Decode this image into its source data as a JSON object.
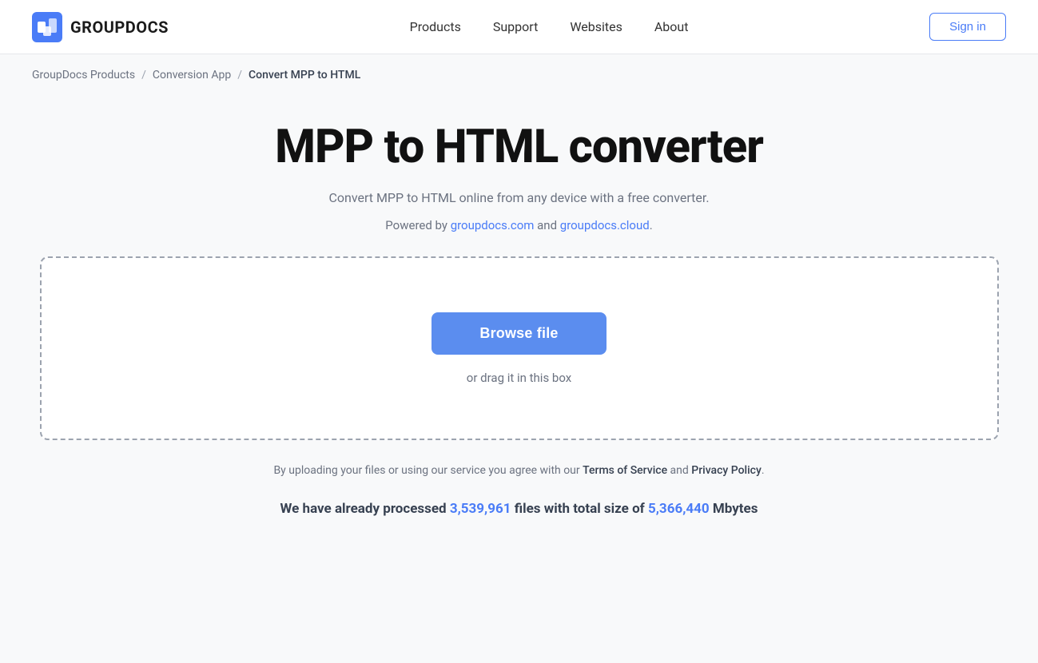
{
  "header": {
    "logo_text": "GROUPDOCS",
    "nav": {
      "products": "Products",
      "support": "Support",
      "websites": "Websites",
      "about": "About"
    },
    "sign_in": "Sign in"
  },
  "breadcrumb": {
    "root": "GroupDocs Products",
    "middle": "Conversion App",
    "current": "Convert MPP to HTML"
  },
  "main": {
    "title": "MPP to HTML converter",
    "subtitle": "Convert MPP to HTML online from any device with a free converter.",
    "powered_by_prefix": "Powered by ",
    "powered_by_link1": "groupdocs.com",
    "powered_by_link1_url": "#",
    "powered_by_and": " and ",
    "powered_by_link2": "groupdocs.cloud",
    "powered_by_link2_url": "#",
    "powered_by_suffix": ".",
    "browse_label": "Browse file",
    "drag_text": "or drag it in this box",
    "terms_prefix": "By uploading your files or using our service you agree with our ",
    "terms_link": "Terms of Service",
    "terms_and": " and ",
    "privacy_link": "Privacy Policy",
    "terms_suffix": ".",
    "stats_prefix": "We have already processed ",
    "stats_count": "3,539,961",
    "stats_middle": " files with total size of ",
    "stats_size": "5,366,440",
    "stats_suffix": " Mbytes"
  }
}
